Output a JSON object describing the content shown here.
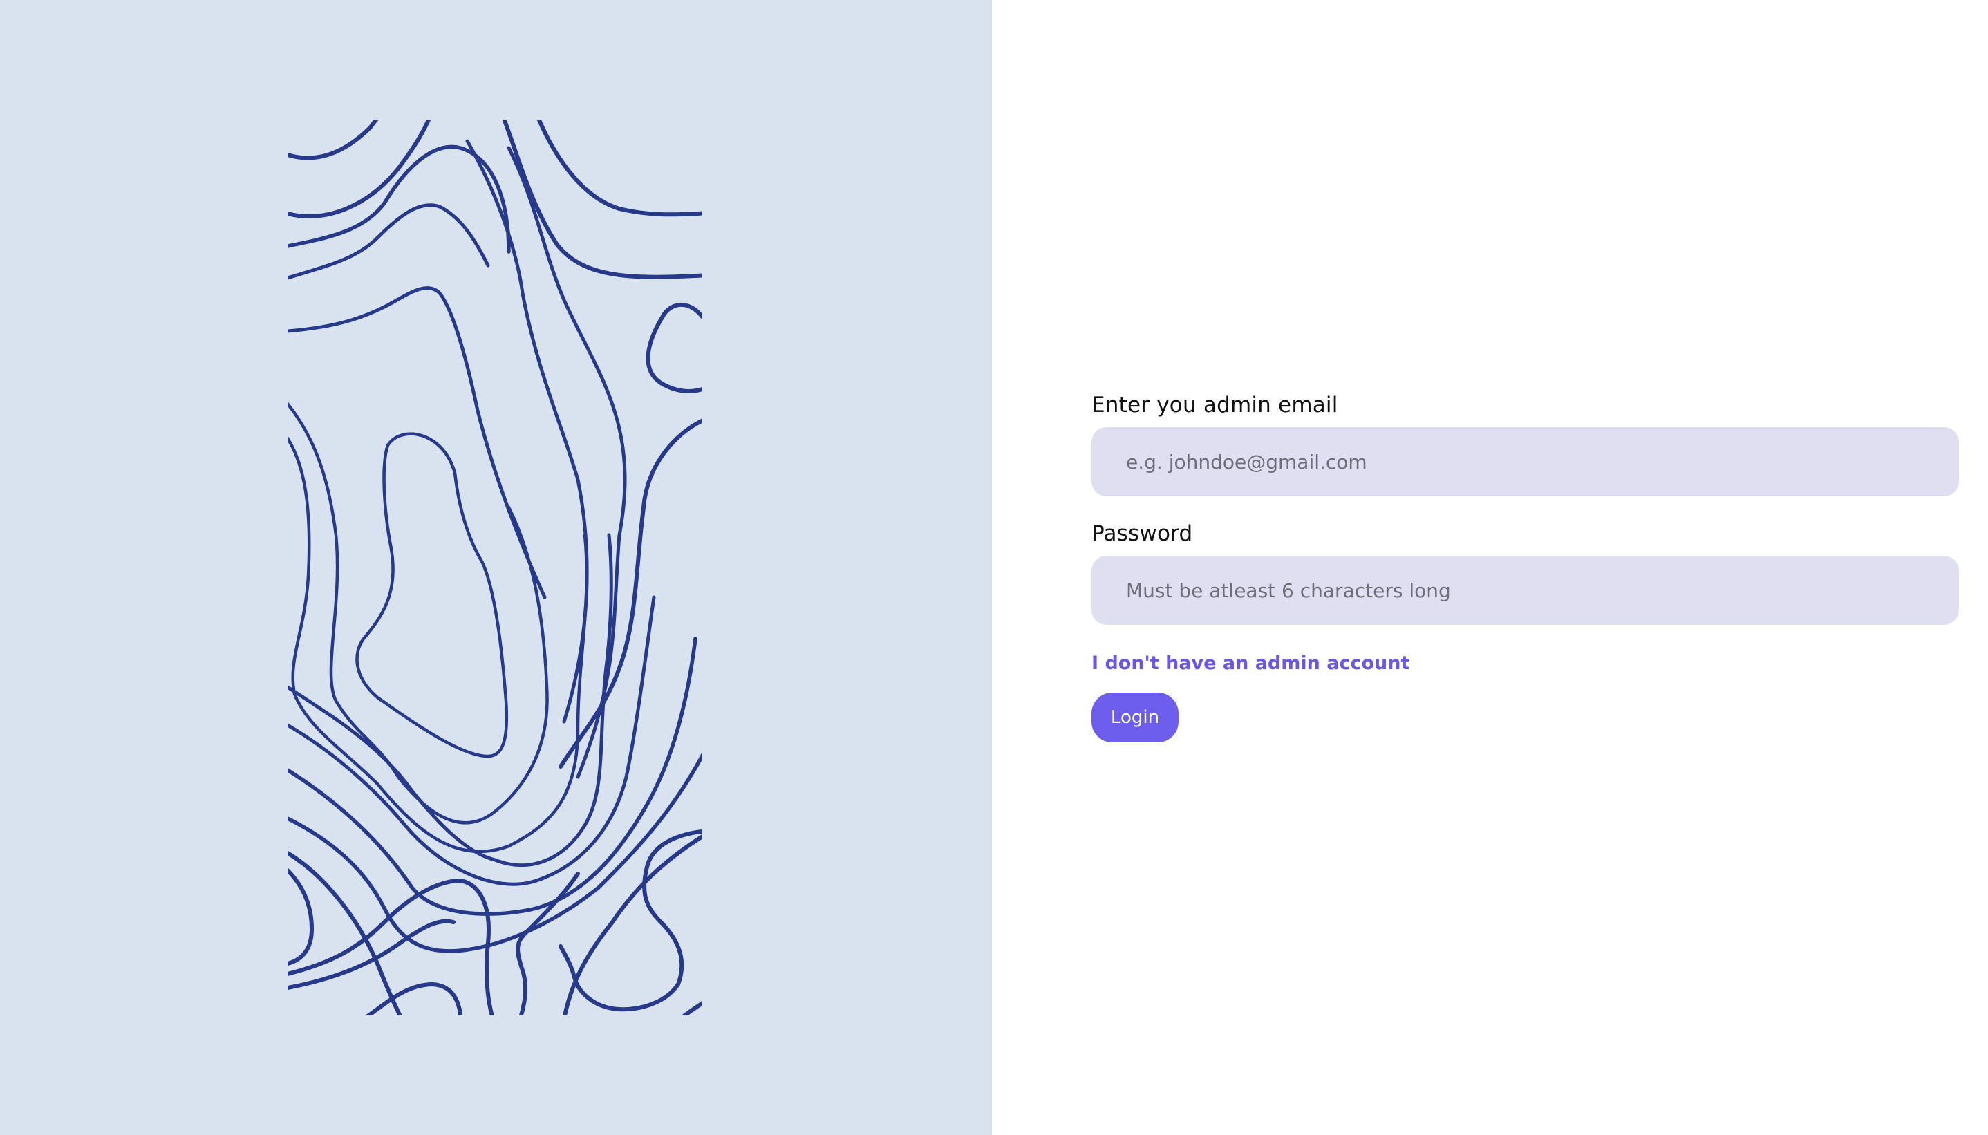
{
  "login_form": {
    "email_label": "Enter you admin email",
    "email_placeholder": "e.g. johndoe@gmail.com",
    "email_value": "",
    "password_label": "Password",
    "password_placeholder": "Must be atleast 6 characters long",
    "password_value": "",
    "no_account_link": "I don't have an admin account",
    "login_button": "Login"
  },
  "colors": {
    "left_panel_bg": "#d9e3ef",
    "topo_lines": "#26398a",
    "input_bg": "#e0def1",
    "accent": "#6d5ded"
  },
  "illustration": {
    "icon": "topographic-contour-lines"
  }
}
